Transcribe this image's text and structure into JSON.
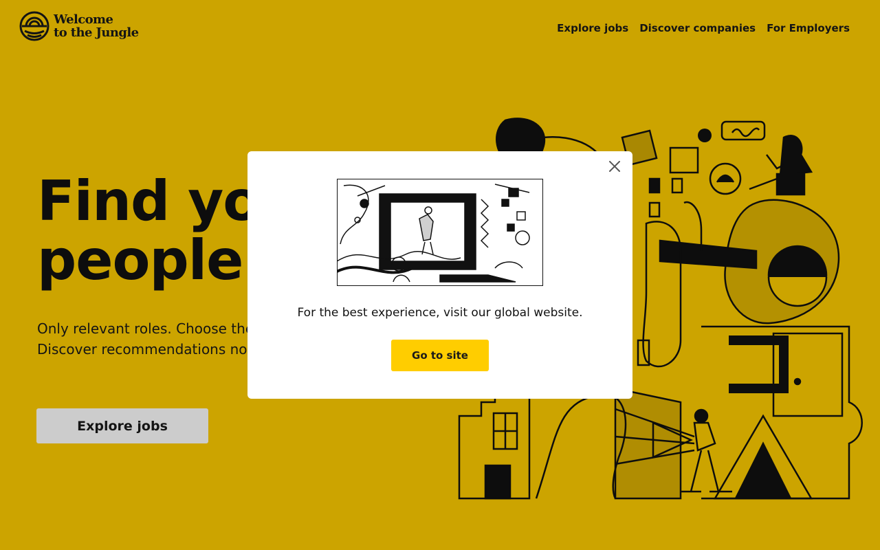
{
  "colors": {
    "brand_yellow": "#FFCD00",
    "overlay": "rgba(0,0,0,0.2)",
    "ink": "#111111",
    "modal_bg": "#FFFFFF"
  },
  "header": {
    "logo": {
      "line1": "Welcome",
      "line2": "to the Jungle",
      "icon": "sunburst-logo-icon"
    },
    "nav": [
      {
        "label": "Explore jobs"
      },
      {
        "label": "Discover companies"
      },
      {
        "label": "For Employers"
      }
    ]
  },
  "hero": {
    "title_line1": "Find your",
    "title_line2": "people",
    "subtitle": "Only relevant roles. Choose the right company for you. Discover recommendations now.",
    "button_label": "Explore jobs"
  },
  "modal": {
    "message": "For the best experience, visit our global website.",
    "button_label": "Go to site",
    "close_icon": "close-icon"
  }
}
